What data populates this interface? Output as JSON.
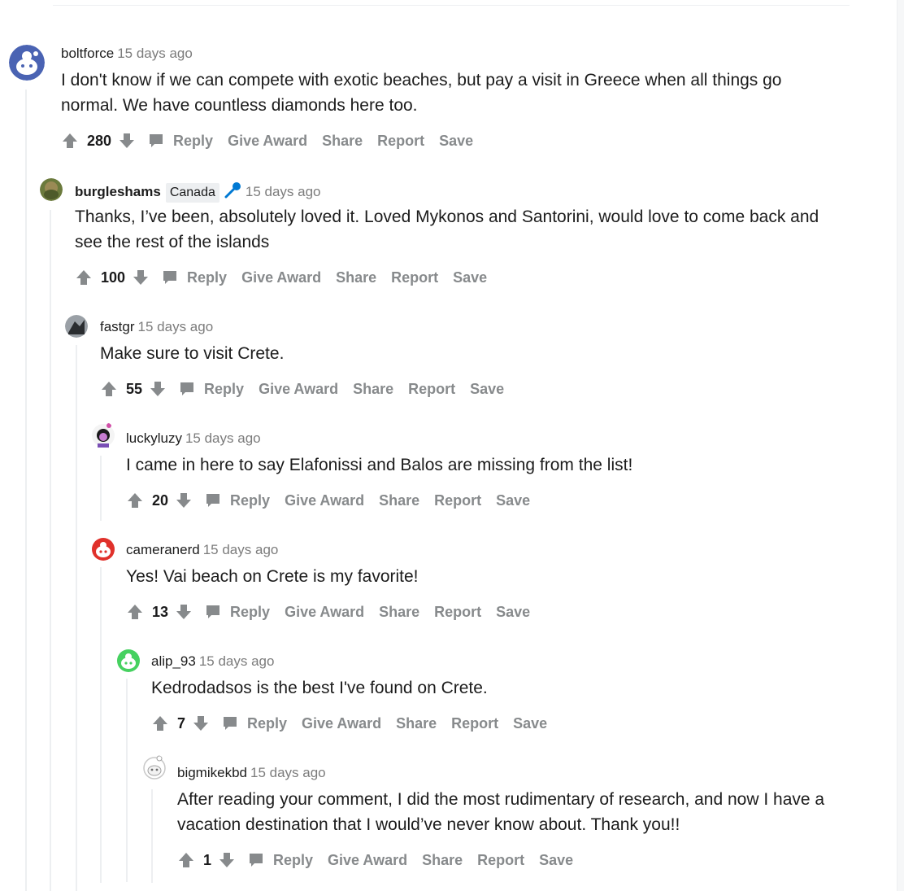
{
  "comments": [
    {
      "username": "boltforce",
      "time": "15 days ago",
      "body": "I don't know if we can compete with exotic beaches, but pay a visit in Greece when all things go normal. We have countless diamonds here too.",
      "score": "280"
    },
    {
      "username": "burgleshams",
      "flair": "Canada",
      "time": "15 days ago",
      "body": "Thanks, I’ve been, absolutely loved it. Loved Mykonos and Santorini, would love to come back and see the rest of the islands",
      "score": "100"
    },
    {
      "username": "fastgr",
      "time": "15 days ago",
      "body": "Make sure to visit Crete.",
      "score": "55"
    },
    {
      "username": "luckyluzy",
      "time": "15 days ago",
      "body": "I came in here to say Elafonissi and Balos are missing from the list!",
      "score": "20"
    },
    {
      "username": "cameranerd",
      "time": "15 days ago",
      "body": "Yes! Vai beach on Crete is my favorite!",
      "score": "13"
    },
    {
      "username": "alip_93",
      "time": "15 days ago",
      "body": "Kedrodadsos is the best I've found on Crete.",
      "score": "7"
    },
    {
      "username": "bigmikekbd",
      "time": "15 days ago",
      "body": "After reading your comment, I did the most rudimentary of research, and now I have a vacation destination that I would’ve never know about. Thank you!!",
      "score": "1"
    }
  ],
  "actions": {
    "reply": "Reply",
    "give_award": "Give Award",
    "share": "Share",
    "report": "Report",
    "save": "Save"
  },
  "icons": {
    "upvote": "upvote-arrow-icon",
    "downvote": "downvote-arrow-icon",
    "reply": "comment-bubble-icon",
    "flair": "microphone-icon"
  },
  "colors": {
    "meta": "#7c7c7c",
    "action": "#878a8c",
    "text": "#1c1c1c",
    "thread_line": "#edeff1",
    "flair_bg": "#edeff1",
    "mic": "#0079d3"
  }
}
